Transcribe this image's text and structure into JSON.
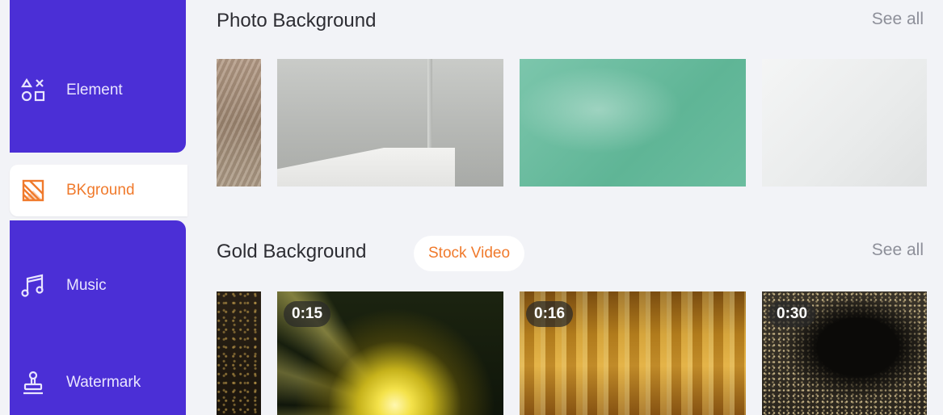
{
  "sidebar": {
    "items": [
      {
        "label": "Element",
        "icon": "shapes-icon"
      },
      {
        "label": "BKground",
        "icon": "background-icon",
        "active": true
      },
      {
        "label": "Music",
        "icon": "music-note-icon"
      },
      {
        "label": "Watermark",
        "icon": "stamp-icon"
      }
    ]
  },
  "sections": {
    "photo": {
      "title": "Photo Background",
      "see_all": "See all"
    },
    "gold": {
      "title": "Gold Background",
      "badge": "Stock Video",
      "see_all": "See all",
      "videos": [
        {
          "duration": "0:15"
        },
        {
          "duration": "0:16"
        },
        {
          "duration": "0:30"
        }
      ]
    }
  },
  "colors": {
    "sidebar_purple": "#4b2fd6",
    "accent_orange": "#f07a2c",
    "page_bg": "#f2f3f7"
  }
}
